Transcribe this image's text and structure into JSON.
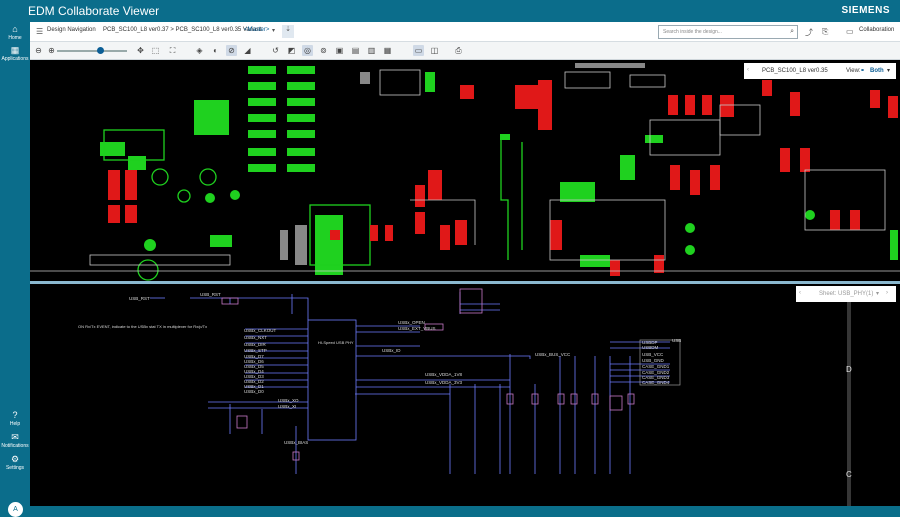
{
  "app": {
    "title": "EDM Collaborate Viewer",
    "brand": "SIEMENS"
  },
  "rail": {
    "home": "Home",
    "applications": "Applications",
    "help": "Help",
    "notifications": "Notifications",
    "settings": "Settings",
    "avatar": "A"
  },
  "nav": {
    "design_navigation": "Design Navigation",
    "path": "PCB_SC100_L8 ver0.37 > PCB_SC100_L8 ver0.35 Variant:",
    "variant": "<Master>",
    "search_placeholder": "Search inside the design...",
    "collaboration": "Collaboration"
  },
  "pcb_popup": {
    "design": "PCB_SC100_L8 ver0.35",
    "view_label": "View:",
    "view_value": "Both"
  },
  "sch_popup": {
    "sheet_label": "Sheet:",
    "sheet_value": "USB_PHY(1)"
  },
  "schematic": {
    "nets": [
      "USB_RST",
      "USB_RST",
      "USBx_CLKOUT",
      "USBx_NXT",
      "USBx_DIR",
      "USBx_STP",
      "USBx_D7",
      "USBx_D6",
      "USBx_D5",
      "USBx_D4",
      "USBx_D3",
      "USBx_D2",
      "USBx_D1",
      "USBx_D0",
      "USBx_OPEN",
      "USBx_EXT_VBUS",
      "USBx_ID",
      "USBx_BUS_VCC",
      "USBx_VDDA_1V8",
      "USBx_VDDA_3V3",
      "USBx_XO",
      "USBx_XI",
      "USBx_BIAS",
      "USB_VCC",
      "USB_GND",
      "CASE_GND1",
      "CASE_GND2",
      "CASE_GND3",
      "CASE_GND4",
      "USBDP",
      "USBDM",
      "USB"
    ],
    "note": "ON Rx/Tx EVENT, indicate to the USBx stat TX in multiplexer for Rx/p/Tx",
    "chip": "HI-Speed USB PHY",
    "sheet_letters": [
      "D",
      "C"
    ]
  },
  "colors": {
    "accent": "#0b6d8b",
    "pcb_green": "#1fd11f",
    "pcb_red": "#e01818",
    "sch_wire": "#6e7cff",
    "sch_comp": "#c87ac8"
  }
}
